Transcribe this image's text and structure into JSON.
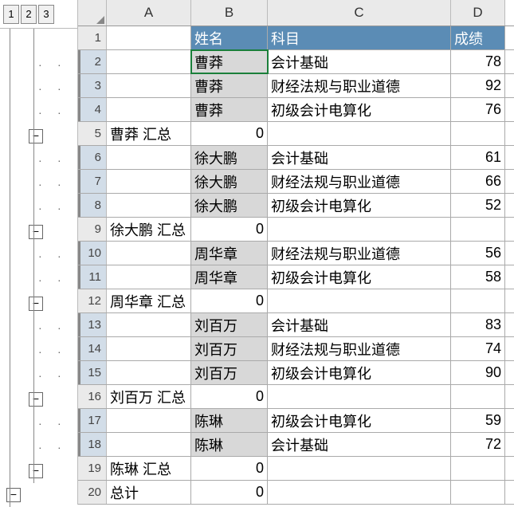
{
  "outline_levels": [
    "1",
    "2",
    "3"
  ],
  "columns": [
    "A",
    "B",
    "C",
    "D"
  ],
  "header": {
    "B": "姓名",
    "C": "科目",
    "D": "成绩"
  },
  "rows": [
    {
      "n": 1,
      "type": "header"
    },
    {
      "n": 2,
      "A": "",
      "B": "曹莽",
      "C": "会计基础",
      "D": "78",
      "shaded": true,
      "active": true,
      "dot": true
    },
    {
      "n": 3,
      "A": "",
      "B": "曹莽",
      "C": "财经法规与职业道德",
      "D": "92",
      "shaded": true,
      "dot": true
    },
    {
      "n": 4,
      "A": "",
      "B": "曹莽",
      "C": "初级会计电算化",
      "D": "76",
      "shaded": true,
      "dot": true
    },
    {
      "n": 5,
      "A": "曹莽 汇总",
      "B": "0",
      "C": "",
      "D": "",
      "collapse": true
    },
    {
      "n": 6,
      "A": "",
      "B": "徐大鹏",
      "C": "会计基础",
      "D": "61",
      "shaded": true,
      "dot": true
    },
    {
      "n": 7,
      "A": "",
      "B": "徐大鹏",
      "C": "财经法规与职业道德",
      "D": "66",
      "shaded": true,
      "dot": true
    },
    {
      "n": 8,
      "A": "",
      "B": "徐大鹏",
      "C": "初级会计电算化",
      "D": "52",
      "shaded": true,
      "dot": true
    },
    {
      "n": 9,
      "A": "徐大鹏 汇总",
      "B": "0",
      "C": "",
      "D": "",
      "collapse": true
    },
    {
      "n": 10,
      "A": "",
      "B": "周华章",
      "C": "财经法规与职业道德",
      "D": "56",
      "shaded": true,
      "dot": true
    },
    {
      "n": 11,
      "A": "",
      "B": "周华章",
      "C": "初级会计电算化",
      "D": "58",
      "shaded": true,
      "dot": true
    },
    {
      "n": 12,
      "A": "周华章 汇总",
      "B": "0",
      "C": "",
      "D": "",
      "collapse": true
    },
    {
      "n": 13,
      "A": "",
      "B": "刘百万",
      "C": "会计基础",
      "D": "83",
      "shaded": true,
      "dot": true
    },
    {
      "n": 14,
      "A": "",
      "B": "刘百万",
      "C": "财经法规与职业道德",
      "D": "74",
      "shaded": true,
      "dot": true
    },
    {
      "n": 15,
      "A": "",
      "B": "刘百万",
      "C": "初级会计电算化",
      "D": "90",
      "shaded": true,
      "dot": true
    },
    {
      "n": 16,
      "A": "刘百万 汇总",
      "B": "0",
      "C": "",
      "D": "",
      "collapse": true
    },
    {
      "n": 17,
      "A": "",
      "B": "陈琳",
      "C": "初级会计电算化",
      "D": "59",
      "shaded": true,
      "dot": true
    },
    {
      "n": 18,
      "A": "",
      "B": "陈琳",
      "C": "会计基础",
      "D": "72",
      "shaded": true,
      "dot": true
    },
    {
      "n": 19,
      "A": "陈琳 汇总",
      "B": "0",
      "C": "",
      "D": "",
      "collapse": true
    },
    {
      "n": 20,
      "A": "总计",
      "B": "0",
      "C": "",
      "D": "",
      "grand": true
    }
  ],
  "chart_data": {
    "type": "table",
    "title": "成绩汇总",
    "columns": [
      "姓名",
      "科目",
      "成绩"
    ],
    "groups": [
      {
        "name": "曹莽",
        "rows": [
          [
            "曹莽",
            "会计基础",
            78
          ],
          [
            "曹莽",
            "财经法规与职业道德",
            92
          ],
          [
            "曹莽",
            "初级会计电算化",
            76
          ]
        ],
        "subtotal": 0
      },
      {
        "name": "徐大鹏",
        "rows": [
          [
            "徐大鹏",
            "会计基础",
            61
          ],
          [
            "徐大鹏",
            "财经法规与职业道德",
            66
          ],
          [
            "徐大鹏",
            "初级会计电算化",
            52
          ]
        ],
        "subtotal": 0
      },
      {
        "name": "周华章",
        "rows": [
          [
            "周华章",
            "财经法规与职业道德",
            56
          ],
          [
            "周华章",
            "初级会计电算化",
            58
          ]
        ],
        "subtotal": 0
      },
      {
        "name": "刘百万",
        "rows": [
          [
            "刘百万",
            "会计基础",
            83
          ],
          [
            "刘百万",
            "财经法规与职业道德",
            74
          ],
          [
            "刘百万",
            "初级会计电算化",
            90
          ]
        ],
        "subtotal": 0
      },
      {
        "name": "陈琳",
        "rows": [
          [
            "陈琳",
            "初级会计电算化",
            59
          ],
          [
            "陈琳",
            "会计基础",
            72
          ]
        ],
        "subtotal": 0
      }
    ],
    "grand_total": 0
  },
  "glyphs": {
    "minus": "−",
    "dot": "·"
  }
}
